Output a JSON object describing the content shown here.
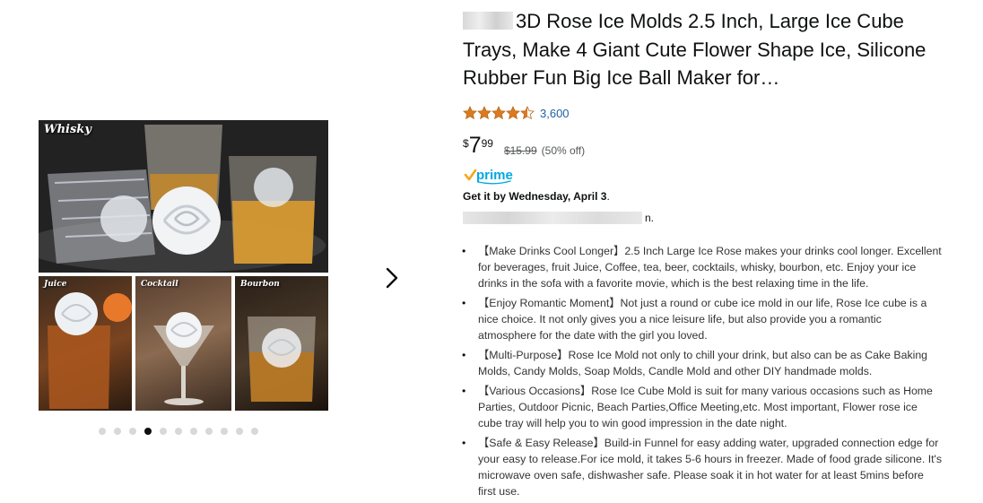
{
  "product": {
    "title": "3D Rose Ice Molds 2.5 Inch, Large Ice Cube Trays, Make 4 Giant Cute Flower Shape Ice, Silicone Rubber Fun Big Ice Ball Maker for…",
    "rating_count": "3,600",
    "rating_value": 4.5,
    "price": {
      "symbol": "$",
      "whole": "7",
      "fraction": "99"
    },
    "list_price": "$15.99",
    "discount": "(50% off)",
    "prime": {
      "check": "✓",
      "label": "prime"
    },
    "delivery": {
      "prefix": "Get it by Wednesday, April 3",
      "suffix": "."
    },
    "redacted_tail": "n.",
    "bullets": [
      "【Make Drinks Cool Longer】2.5 Inch Large Ice Rose makes your drinks cool longer. Excellent for beverages, fruit Juice, Coffee, tea, beer, cocktails, whisky, bourbon, etc. Enjoy your ice drinks in the sofa with a favorite movie, which is the best relaxing time in the life.",
      "【Enjoy Romantic Moment】Not just a round or cube ice mold in our life, Rose Ice cube is a nice choice. It not only gives you a nice leisure life, but also provide you a romantic atmosphere for the date with the girl you loved.",
      "【Multi-Purpose】Rose Ice Mold not only to chill your drink, but also can be as Cake Baking Molds, Candy Molds, Soap Molds, Candle Mold and other DIY handmade molds.",
      "【Various Occasions】Rose Ice Cube Mold is suit for many various occasions such as Home Parties, Outdoor Picnic, Beach Parties,Office Meeting,etc. Most important, Flower rose ice cube tray will help you to win good impression in the date night.",
      "【Safe & Easy Release】Build-in Funnel for easy adding water, upgraded connection edge for your easy to release.For ice mold, it takes 5-6 hours in freezer. Made of food grade silicone. It's microwave oven safe, dishwasher safe. Please soak it in hot water for at least 5mins before first use."
    ]
  },
  "gallery": {
    "main_label": "Whisky",
    "tiles": [
      "Juice",
      "Cocktail",
      "Bourbon"
    ],
    "dot_count": 11,
    "active_dot": 3,
    "next_icon": "chevron-right-icon"
  },
  "colors": {
    "link": "#2162a1",
    "star": "#de7921",
    "prime": "#00a8e1",
    "prime_check": "#f7a51c"
  }
}
